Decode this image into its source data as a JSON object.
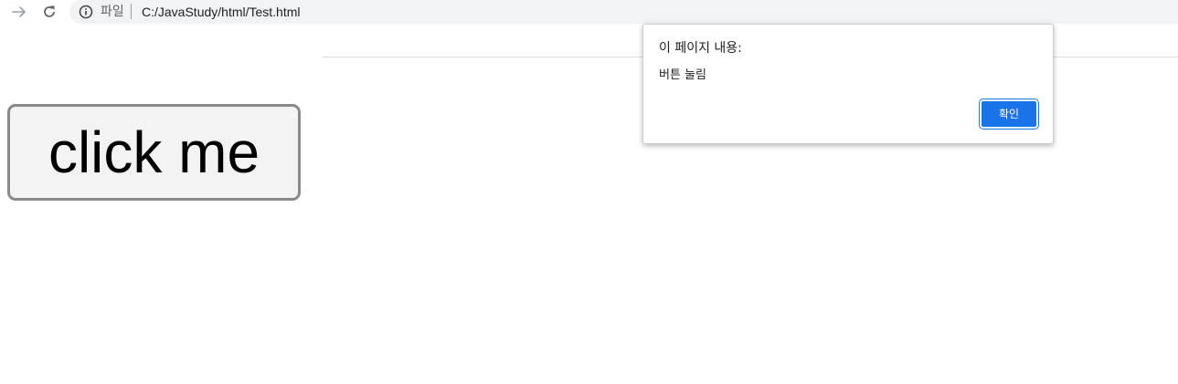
{
  "browser": {
    "scheme_label": "파일",
    "url": "C:/JavaStudy/html/Test.html",
    "icons": {
      "forward": "forward-arrow-icon",
      "reload": "reload-icon",
      "site_info": "info-icon"
    }
  },
  "page": {
    "button_label": "click me"
  },
  "dialog": {
    "title": "이 페이지 내용:",
    "message": "버튼 눌림",
    "ok_label": "확인",
    "accent_color": "#1a73e8"
  }
}
